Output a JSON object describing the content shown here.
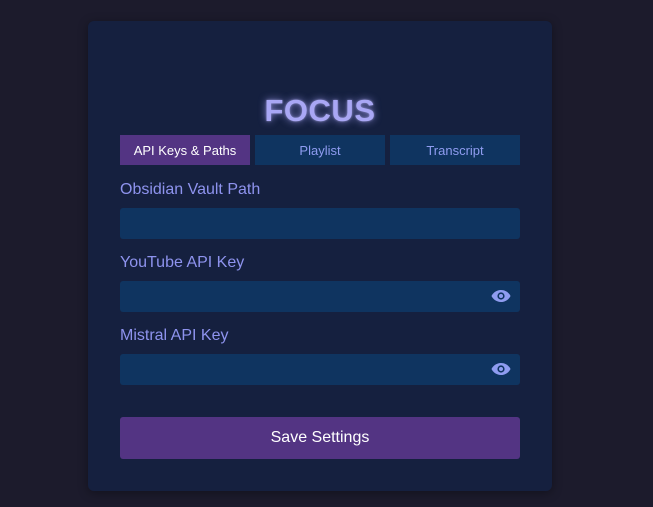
{
  "app": {
    "title": "FOCUS"
  },
  "tabs": [
    {
      "label": "API Keys & Paths",
      "active": true
    },
    {
      "label": "Playlist",
      "active": false
    },
    {
      "label": "Transcript",
      "active": false
    }
  ],
  "fields": {
    "vault_path": {
      "label": "Obsidian Vault Path",
      "value": ""
    },
    "youtube_key": {
      "label": "YouTube API Key",
      "value": ""
    },
    "mistral_key": {
      "label": "Mistral API Key",
      "value": ""
    }
  },
  "actions": {
    "save_label": "Save Settings"
  },
  "colors": {
    "background": "#1c1b2c",
    "panel": "#15203f",
    "input": "#0f3460",
    "accent": "#533483",
    "label": "#8e93ee",
    "title": "#a9a7f5"
  },
  "icons": {
    "reveal": "eye-icon"
  }
}
